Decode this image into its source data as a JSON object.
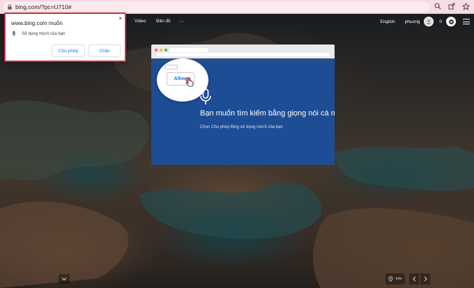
{
  "browser": {
    "url": "bing.com/?pc=U710#",
    "icons": [
      "lock-icon",
      "zoom-icon",
      "share-icon",
      "bookmark-star-icon"
    ]
  },
  "header": {
    "nav_items": [
      "Video",
      "Bản đồ",
      "⋯"
    ],
    "language": "English",
    "username": "phuong",
    "reward_points": "0"
  },
  "permission_popup": {
    "title": "www.bing.com muốn",
    "description": "Sử dụng micrô của bạn",
    "allow_label": "Cho phép",
    "block_label": "Chặn",
    "close_symbol": "×"
  },
  "instruction_card": {
    "allow_label": "Allow",
    "title": "Bạn muốn tìm kiếm bằng giọng nói cá m",
    "subtitle": "Chọn Cho phép Bing sử dụng micrô của bạn"
  },
  "footer": {
    "info_label": "Info"
  },
  "colors": {
    "accent": "#1a73e8",
    "popup_border": "#d32f45",
    "card_bg": "#1d4d94",
    "addressbar_bg": "#f6dce3"
  }
}
